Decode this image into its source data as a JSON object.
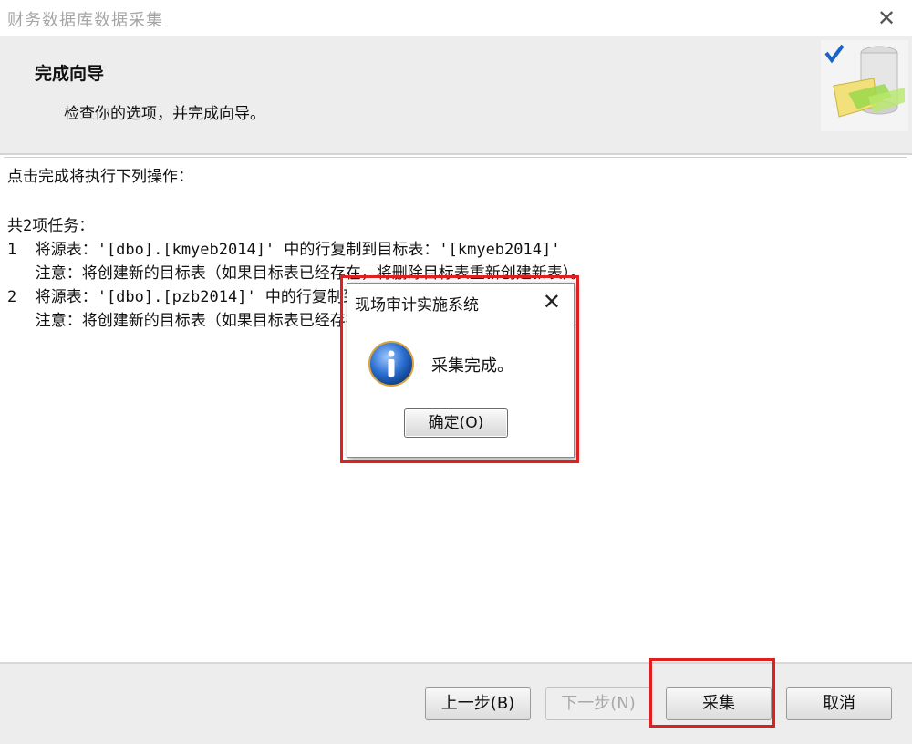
{
  "window": {
    "title": "财务数据库数据采集",
    "close_glyph": "✕"
  },
  "header": {
    "title": "完成向导",
    "subtitle": "检查你的选项，并完成向导。",
    "icon": "database-check-icon"
  },
  "log": {
    "lines": [
      "点击完成将执行下列操作：",
      "",
      "共2项任务：",
      "1  将源表：'[dbo].[kmyeb2014]' 中的行复制到目标表：'[kmyeb2014]'",
      "   注意：将创建新的目标表（如果目标表已经存在，将删除目标表重新创建新表）。",
      "2  将源表：'[dbo].[pzb2014]' 中的行复制到目标表：'[pzb2014]'",
      "   注意：将创建新的目标表（如果目标表已经存在，将删除目标表重新创建新表）。"
    ]
  },
  "dialog": {
    "title": "现场审计实施系统",
    "close_glyph": "✕",
    "message": "采集完成。",
    "ok_label": "确定(O)",
    "icon": "info-icon"
  },
  "footer": {
    "back_label": "上一步(B)",
    "next_label": "下一步(N)",
    "collect_label": "采集",
    "cancel_label": "取消"
  },
  "colors": {
    "highlight": "#e02020",
    "info_blue": "#1f5fb8"
  }
}
